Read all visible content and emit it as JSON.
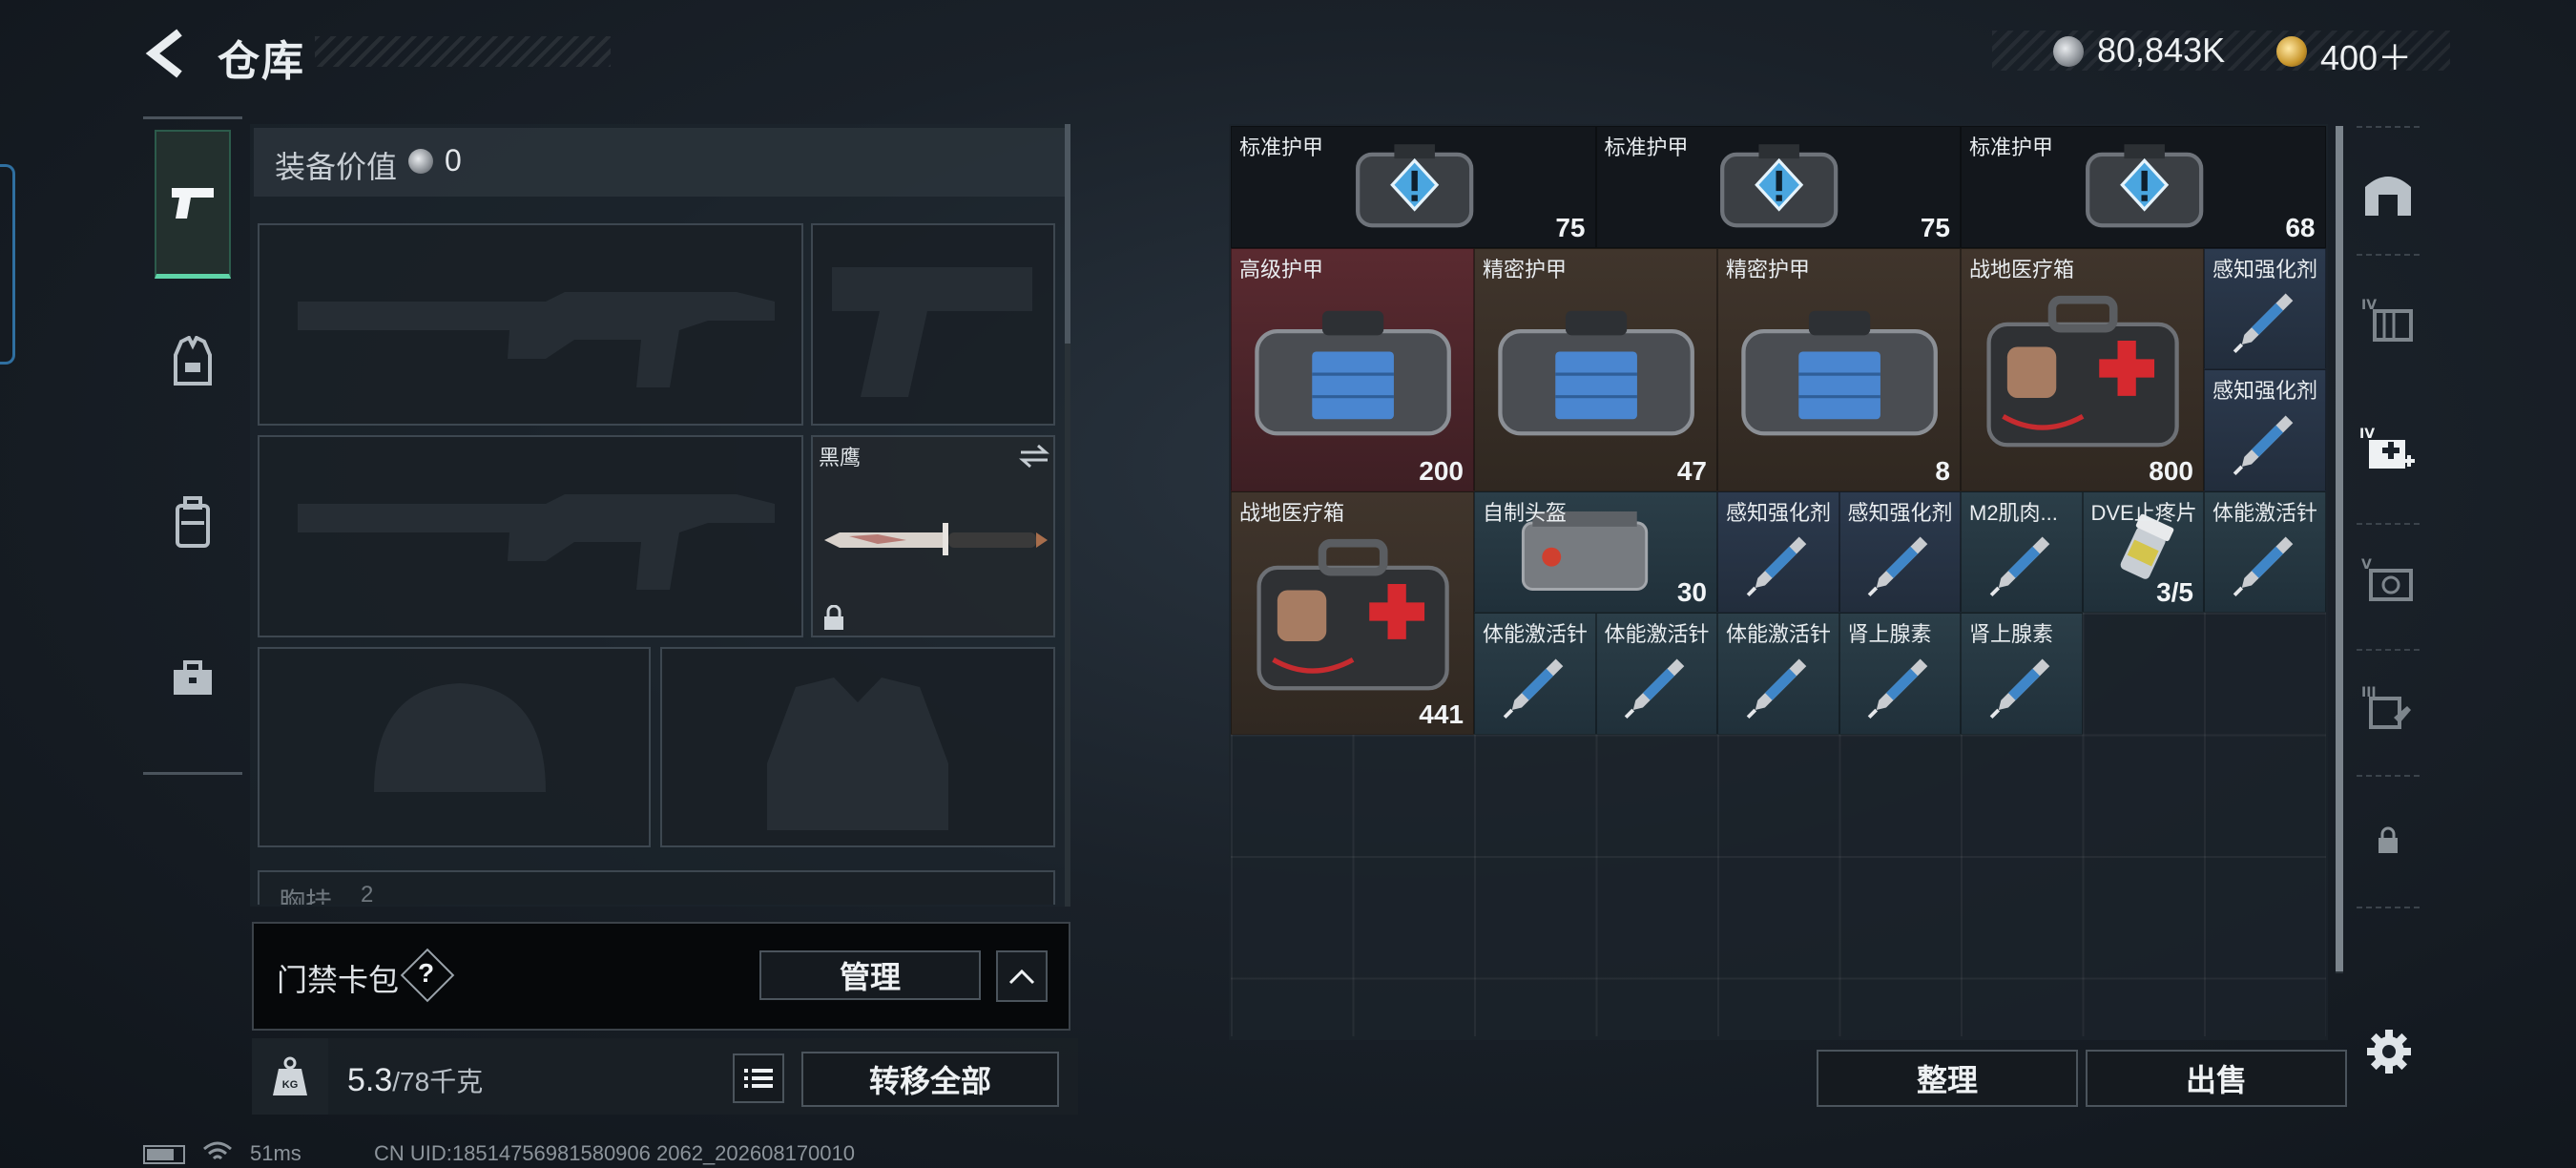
{
  "header": {
    "title": "仓库",
    "currency_silver": "80,843K",
    "currency_gold": "400＋"
  },
  "equipment": {
    "value_label": "装备价值",
    "value": "0",
    "knife_slot_label": "黑鹰",
    "vest_label": "胸挂",
    "vest_count": "2"
  },
  "access_card": {
    "label": "门禁卡包",
    "help": "?",
    "manage_button": "管理"
  },
  "weight": {
    "current": "5.3",
    "max": "/78千克",
    "kg_label": "KG",
    "transfer_all_button": "转移全部"
  },
  "storage": {
    "items": [
      {
        "name": "标准护甲",
        "value": "75",
        "icon": "armor-warning-icon"
      },
      {
        "name": "标准护甲",
        "value": "75",
        "icon": "armor-warning-icon"
      },
      {
        "name": "标准护甲",
        "value": "68",
        "icon": "armor-warning-icon"
      },
      {
        "name": "高级护甲",
        "value": "200",
        "icon": "armor-icon"
      },
      {
        "name": "精密护甲",
        "value": "47",
        "icon": "armor-icon"
      },
      {
        "name": "精密护甲",
        "value": "8",
        "icon": "armor-icon"
      },
      {
        "name": "战地医疗箱",
        "value": "800",
        "icon": "medkit-icon"
      },
      {
        "name": "感知强化剂",
        "value": "",
        "icon": "injector-icon"
      },
      {
        "name": "感知强化剂",
        "value": "",
        "icon": "injector-icon"
      },
      {
        "name": "战地医疗箱",
        "value": "441",
        "icon": "medkit-icon"
      },
      {
        "name": "自制头盔",
        "value": "30",
        "icon": "helmet-icon"
      },
      {
        "name": "感知强化剂",
        "value": "",
        "icon": "injector-icon"
      },
      {
        "name": "感知强化剂",
        "value": "",
        "icon": "injector-icon"
      },
      {
        "name": "M2肌肉...",
        "value": "",
        "icon": "injector-icon"
      },
      {
        "name": "DVE止疼片",
        "value": "3/5",
        "icon": "pill-bottle-icon"
      },
      {
        "name": "体能激活针",
        "value": "",
        "icon": "injector-icon"
      },
      {
        "name": "体能激活针",
        "value": "",
        "icon": "injector-icon"
      },
      {
        "name": "体能激活针",
        "value": "",
        "icon": "injector-icon"
      },
      {
        "name": "体能激活针",
        "value": "",
        "icon": "injector-icon"
      },
      {
        "name": "肾上腺素",
        "value": "",
        "icon": "injector-icon"
      },
      {
        "name": "肾上腺素",
        "value": "",
        "icon": "injector-icon"
      }
    ],
    "sort_button": "整理",
    "sell_button": "出售"
  },
  "status": {
    "ping": "51ms",
    "uid": "CN UID:18514756981580906 2062_202608170010"
  },
  "colors": {
    "accent_green": "#5fd4a8",
    "panel_dark": "#06080a",
    "rare_red": "#5a2a30"
  }
}
